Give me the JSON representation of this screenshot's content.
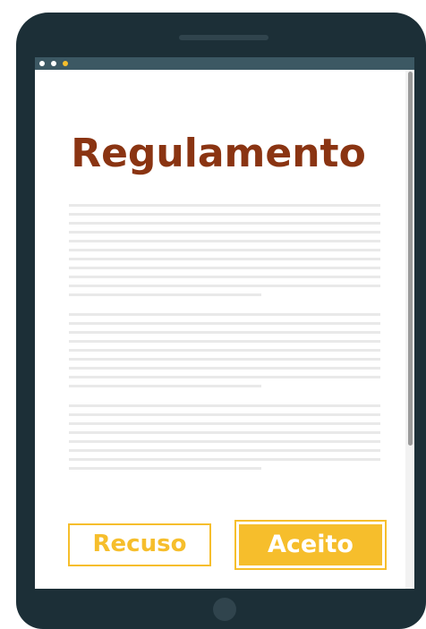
{
  "document": {
    "title": "Regulamento",
    "paragraphs": [
      {
        "lines": 11
      },
      {
        "lines": 9
      },
      {
        "lines": 8
      }
    ]
  },
  "actions": {
    "refuse_label": "Recuso",
    "accept_label": "Aceito"
  },
  "colors": {
    "device_body": "#1c2f37",
    "titlebar": "#3c5863",
    "title_text": "#8a3412",
    "accent": "#f6be2c",
    "text_placeholder": "#e9e9e9"
  },
  "icons": {
    "window_dots": [
      "window-dot-icon",
      "window-dot-icon",
      "window-dot-highlight-icon"
    ],
    "home": "home-button-icon"
  }
}
